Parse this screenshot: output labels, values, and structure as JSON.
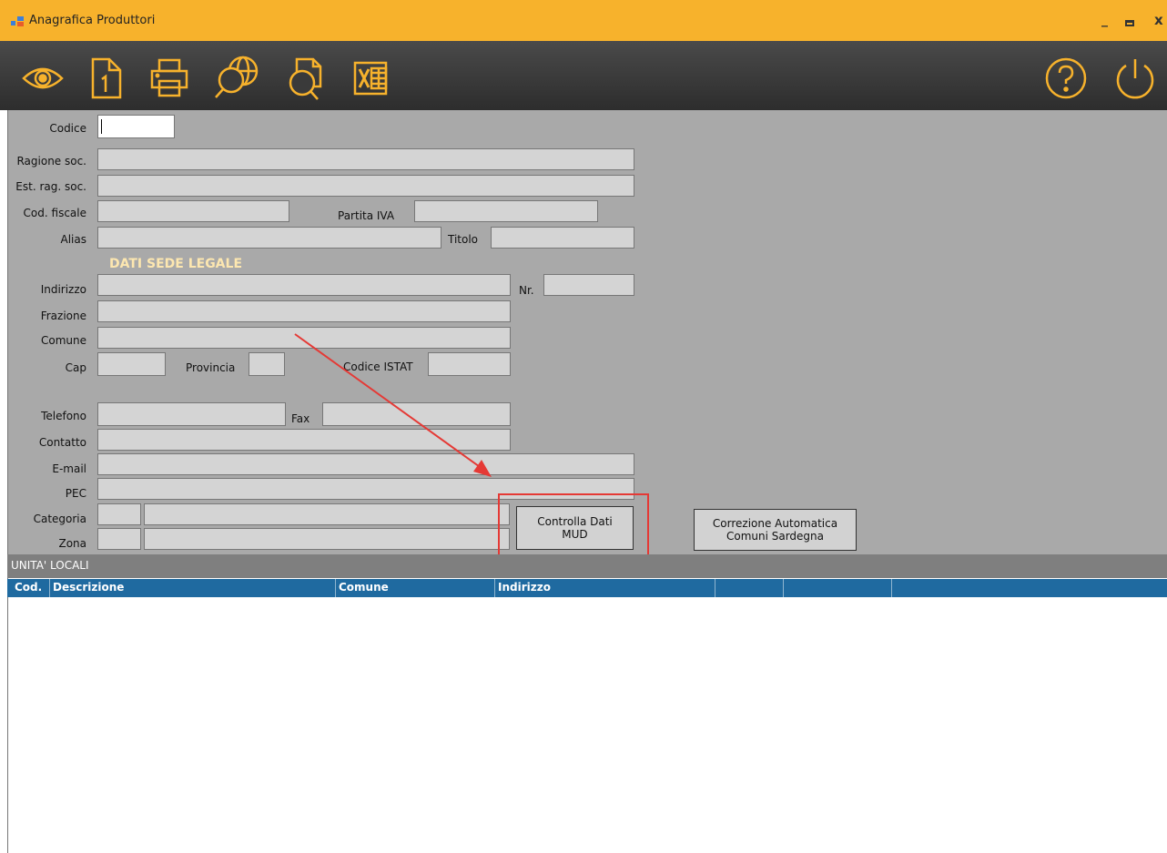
{
  "window": {
    "title": "Anagrafica Produttori",
    "minimize": "_",
    "maximize": "▭",
    "close": "x"
  },
  "form": {
    "codice": {
      "label": "Codice",
      "value": ""
    },
    "ragione_soc": {
      "label": "Ragione soc.",
      "value": ""
    },
    "est_rag_soc": {
      "label": "Est. rag. soc.",
      "value": ""
    },
    "cod_fiscale": {
      "label": "Cod. fiscale",
      "value": ""
    },
    "partita_iva": {
      "label": "Partita IVA",
      "value": ""
    },
    "alias": {
      "label": "Alias",
      "value": ""
    },
    "titolo": {
      "label": "Titolo",
      "value": ""
    },
    "section_title": "DATI SEDE LEGALE",
    "indirizzo": {
      "label": "Indirizzo",
      "value": ""
    },
    "nr": {
      "label": "Nr.",
      "value": ""
    },
    "frazione": {
      "label": "Frazione",
      "value": ""
    },
    "comune": {
      "label": "Comune",
      "value": ""
    },
    "cap": {
      "label": "Cap",
      "value": ""
    },
    "provincia": {
      "label": "Provincia",
      "value": ""
    },
    "codice_istat": {
      "label": "Codice ISTAT",
      "value": ""
    },
    "telefono": {
      "label": "Telefono",
      "value": ""
    },
    "fax": {
      "label": "Fax",
      "value": ""
    },
    "contatto": {
      "label": "Contatto",
      "value": ""
    },
    "email": {
      "label": "E-mail",
      "value": ""
    },
    "pec": {
      "label": "PEC",
      "value": ""
    },
    "categoria": {
      "label": "Categoria",
      "value": ""
    },
    "zona": {
      "label": "Zona",
      "value": ""
    }
  },
  "buttons": {
    "controlla_line1": "Controlla Dati",
    "controlla_line2": "MUD",
    "correzione_line1": "Correzione Automatica",
    "correzione_line2": "Comuni Sardegna"
  },
  "section": {
    "label": "UNITA' LOCALI"
  },
  "grid": {
    "columns": [
      "Cod.",
      "Descrizione",
      "Comune",
      "Indirizzo",
      "",
      "",
      ""
    ]
  },
  "colors": {
    "titlebar": "#f7b22c",
    "toolbar": "#3a3a3a",
    "form_bg": "#a9a9a9",
    "grid_header": "#1f6aa0",
    "annotation": "#e53935",
    "section_title": "#fde7b0"
  },
  "toolbar_icons": [
    "eye-icon",
    "page-one-icon",
    "print-icon",
    "web-search-icon",
    "document-search-icon",
    "excel-icon",
    "help-icon",
    "power-icon"
  ]
}
